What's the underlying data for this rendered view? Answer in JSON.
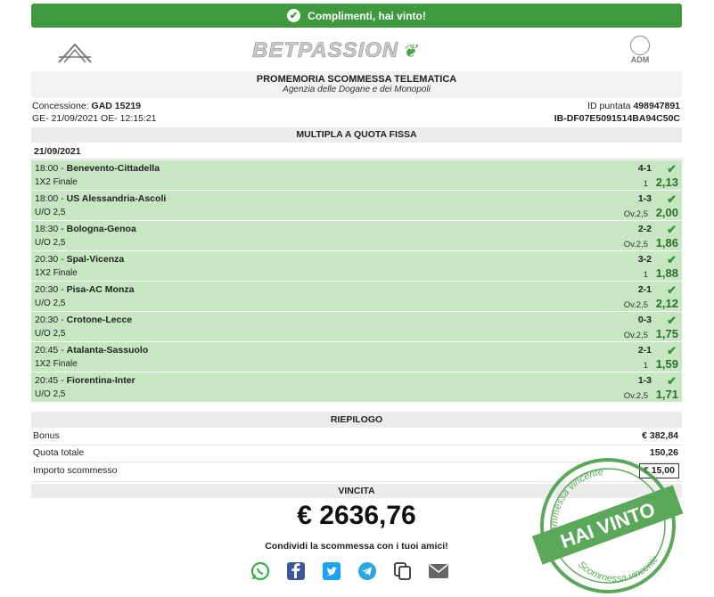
{
  "banner": {
    "text": "Complimenti, hai vinto!"
  },
  "header": {
    "logo": "BETPASSION",
    "adm_right": "ADM",
    "adm_left": "ADM"
  },
  "title": {
    "line1": "PROMEMORIA SCOMMESSA TELEMATICA",
    "line2": "Agenzia delle Dogane e dei Monopoli"
  },
  "info": {
    "concessione_label": "Concessione:",
    "concessione_value": "GAD 15219",
    "id_label": "ID puntata",
    "id_value": "498947891",
    "ge_line": "GE- 21/09/2021 OE- 12:15:21",
    "ib_line": "IB-DF07E5091514BA94C50C"
  },
  "bet_type": "MULTIPLA A QUOTA FISSA",
  "date": "21/09/2021",
  "events": [
    {
      "time": "18:00",
      "match": "Benevento-Cittadella",
      "market": "1X2 Finale",
      "score": "4-1",
      "selection": "1",
      "odds": "2,13"
    },
    {
      "time": "18:00",
      "match": "US Alessandria-Ascoli",
      "market": "U/O 2,5",
      "score": "1-3",
      "selection": "Ov.2,5",
      "odds": "2,00"
    },
    {
      "time": "18:30",
      "match": "Bologna-Genoa",
      "market": "U/O 2,5",
      "score": "2-2",
      "selection": "Ov.2,5",
      "odds": "1,86"
    },
    {
      "time": "20:30",
      "match": "Spal-Vicenza",
      "market": "1X2 Finale",
      "score": "3-2",
      "selection": "1",
      "odds": "1,88"
    },
    {
      "time": "20:30",
      "match": "Pisa-AC Monza",
      "market": "U/O 2,5",
      "score": "2-1",
      "selection": "Ov.2,5",
      "odds": "2,12"
    },
    {
      "time": "20:30",
      "match": "Crotone-Lecce",
      "market": "U/O 2,5",
      "score": "0-3",
      "selection": "Ov.2,5",
      "odds": "1,75"
    },
    {
      "time": "20:45",
      "match": "Atalanta-Sassuolo",
      "market": "1X2 Finale",
      "score": "2-1",
      "selection": "1",
      "odds": "1,59"
    },
    {
      "time": "20:45",
      "match": "Fiorentina-Inter",
      "market": "U/O 2,5",
      "score": "1-3",
      "selection": "Ov.2,5",
      "odds": "1,71"
    }
  ],
  "summary": {
    "title": "RIEPILOGO",
    "bonus_label": "Bonus",
    "bonus_value": "€ 382,84",
    "quota_label": "Quota totale",
    "quota_value": "150,26",
    "importo_label": "Importo scommesso",
    "importo_value": "€ 15,00"
  },
  "vincita": {
    "label": "VINCITA",
    "amount": "€ 2636,76"
  },
  "share": {
    "text": "Condividi la scommessa con i tuoi amici!"
  },
  "stamp": {
    "top": "Scommessa vincente",
    "main": "HAI VINTO",
    "bottom": "Scommessa vincente"
  },
  "colors": {
    "green": "#3f9a3f",
    "row": "#c6e7c2"
  }
}
